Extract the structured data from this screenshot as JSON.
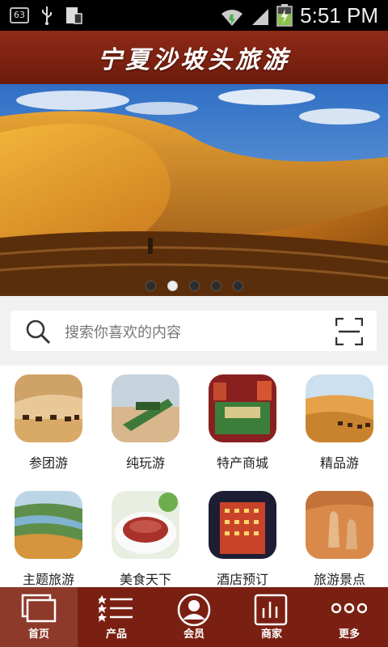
{
  "status_bar": {
    "badge": "63",
    "time": "5:51 PM"
  },
  "header": {
    "title": "宁夏沙坡头旅游"
  },
  "banner": {
    "pages": 5,
    "active_page": 2
  },
  "search": {
    "placeholder": "搜索你喜欢的内容"
  },
  "categories": [
    {
      "label": "参团游"
    },
    {
      "label": "纯玩游"
    },
    {
      "label": "特产商城"
    },
    {
      "label": "精品游"
    },
    {
      "label": "主题旅游"
    },
    {
      "label": "美食天下"
    },
    {
      "label": "酒店预订"
    },
    {
      "label": "旅游景点"
    }
  ],
  "tabs": [
    {
      "label": "首页",
      "icon": "home-icon",
      "active": true
    },
    {
      "label": "产品",
      "icon": "list-icon",
      "active": false
    },
    {
      "label": "会员",
      "icon": "member-icon",
      "active": false
    },
    {
      "label": "商家",
      "icon": "merchant-icon",
      "active": false
    },
    {
      "label": "更多",
      "icon": "more-icon",
      "active": false
    }
  ],
  "colors": {
    "brand": "#7a2012",
    "tab_active": "#8e3a2b"
  }
}
